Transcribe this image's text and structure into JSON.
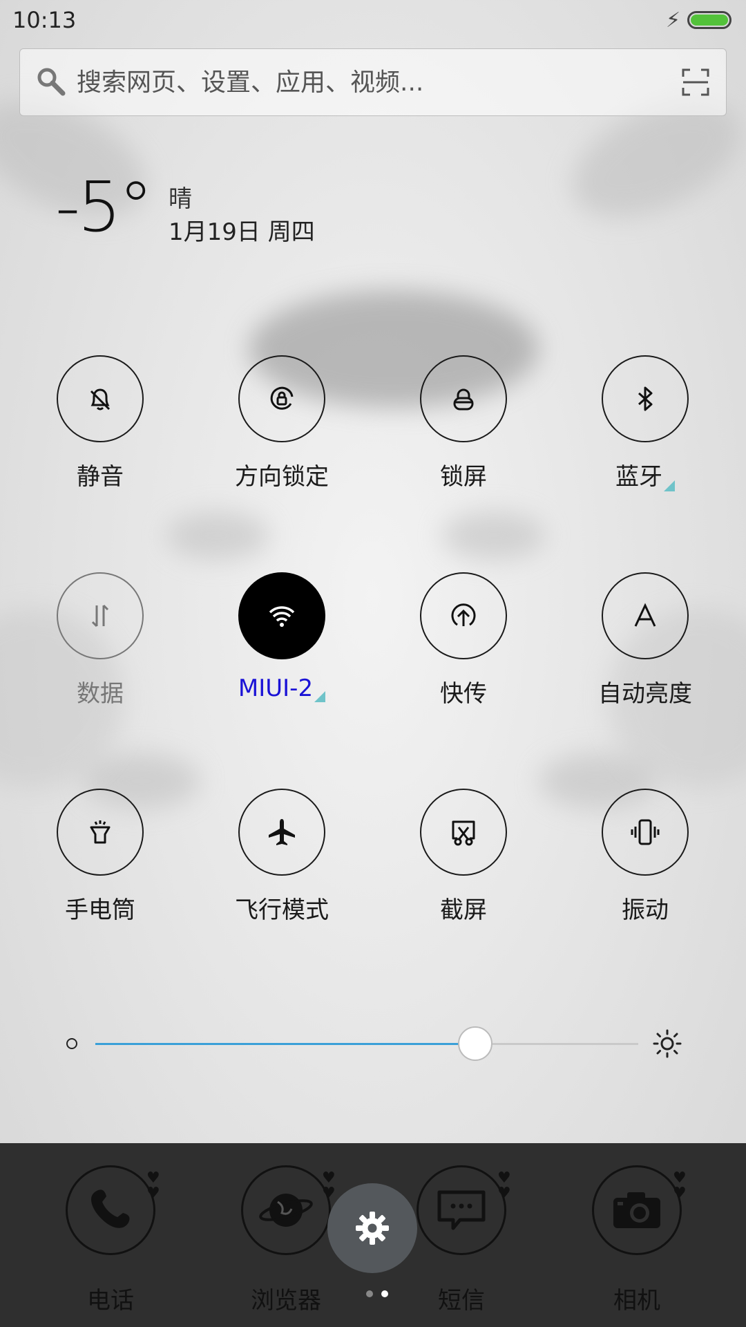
{
  "status": {
    "time": "10:13",
    "charging_icon": "bolt-icon",
    "battery_color": "#53c23a"
  },
  "search": {
    "placeholder": "搜索网页、设置、应用、视频..."
  },
  "weather": {
    "temp": "-5°",
    "condition": "晴",
    "date": "1月19日 周四"
  },
  "toggles": [
    {
      "label": "静音",
      "icon": "bell-off-icon",
      "state": "off"
    },
    {
      "label": "方向锁定",
      "icon": "rotation-lock-icon",
      "state": "off"
    },
    {
      "label": "锁屏",
      "icon": "lock-icon",
      "state": "off"
    },
    {
      "label": "蓝牙",
      "icon": "bluetooth-icon",
      "state": "off"
    },
    {
      "label": "数据",
      "icon": "mobile-data-icon",
      "state": "disabled"
    },
    {
      "label": "MIUI-2",
      "icon": "wifi-icon",
      "state": "on"
    },
    {
      "label": "快传",
      "icon": "share-upload-icon",
      "state": "off"
    },
    {
      "label": "自动亮度",
      "icon": "auto-brightness-icon",
      "state": "off"
    },
    {
      "label": "手电筒",
      "icon": "flashlight-icon",
      "state": "off"
    },
    {
      "label": "飞行模式",
      "icon": "airplane-icon",
      "state": "off"
    },
    {
      "label": "截屏",
      "icon": "screenshot-icon",
      "state": "off"
    },
    {
      "label": "振动",
      "icon": "vibrate-icon",
      "state": "off"
    }
  ],
  "brightness": {
    "level": 0.7,
    "track_color": "#3aa0d8"
  },
  "dock": {
    "apps": [
      {
        "label": "电话",
        "icon": "phone-icon"
      },
      {
        "label": "浏览器",
        "icon": "browser-globe-icon"
      },
      {
        "label": "短信",
        "icon": "message-icon"
      },
      {
        "label": "相机",
        "icon": "camera-icon"
      }
    ],
    "settings_icon": "gear-icon",
    "page_indicator": {
      "pages": 2,
      "current": 2
    }
  }
}
